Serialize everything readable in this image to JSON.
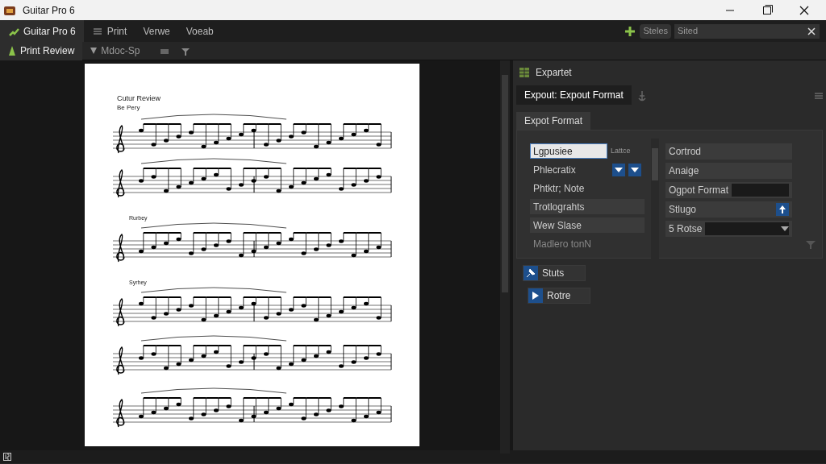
{
  "window": {
    "title": "Guitar Pro 6"
  },
  "menu": [
    {
      "label": "Guitar Pro 6",
      "selected": true
    },
    {
      "label": "Print",
      "selected": false
    },
    {
      "label": "Verwe",
      "selected": false
    },
    {
      "label": "Voeab",
      "selected": false
    }
  ],
  "top_right": {
    "button": "Steles",
    "search_value": "Sited"
  },
  "toolbar": {
    "tab": "Print Review",
    "dropdown": "Mdoc-Sp"
  },
  "sheet": {
    "title": "Cutur Review",
    "subtitle": "Be Pery",
    "sections": [
      {
        "label": "Rurbey"
      },
      {
        "label": "Syrhey"
      }
    ]
  },
  "panel": {
    "title": "Expartet",
    "tab": "Expout: Expout Format",
    "subtab": "Expot Format",
    "left": [
      {
        "kind": "input",
        "value": "Lgpusiee",
        "note": "Lattce"
      },
      {
        "kind": "spinner",
        "label": "Phlecratix"
      },
      {
        "kind": "text",
        "label": "Phtktr; Note"
      },
      {
        "kind": "item",
        "label": "Trotlograhts"
      },
      {
        "kind": "item",
        "label": "Wew Slase"
      },
      {
        "kind": "dim",
        "label": "Madlero tonN"
      }
    ],
    "right": [
      {
        "kind": "item",
        "label": "Cortrod"
      },
      {
        "kind": "item",
        "label": "Anaige"
      },
      {
        "kind": "field",
        "label": "Ogpot Format"
      },
      {
        "kind": "stepper",
        "label": "Stlugo"
      },
      {
        "kind": "select",
        "label": "5 Rotse"
      }
    ],
    "actions": [
      {
        "label": "Stuts"
      },
      {
        "label": "Rotre"
      }
    ]
  }
}
